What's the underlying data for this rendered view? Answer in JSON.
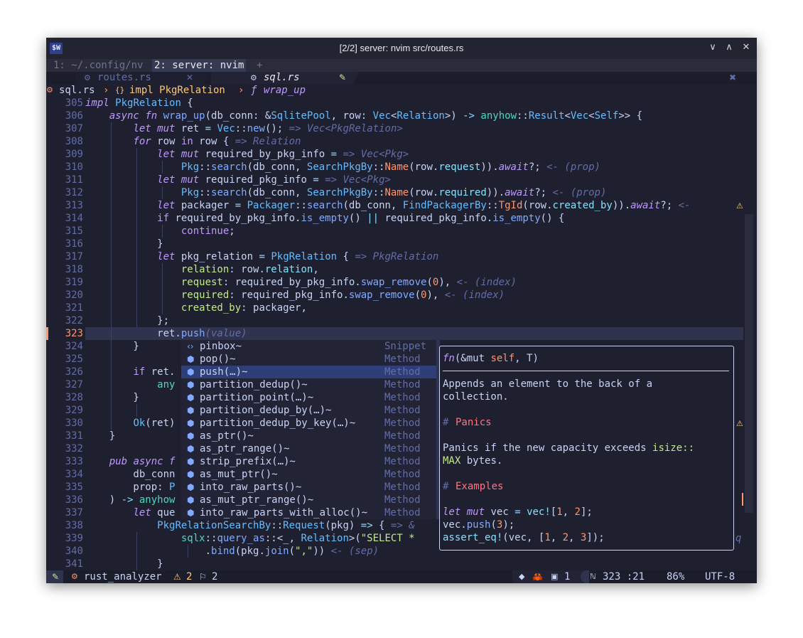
{
  "window": {
    "title": "[2/2] server: nvim src/routes.rs",
    "app_icon": "$W",
    "buttons": {
      "minimize": "∨",
      "maximize": "∧",
      "close": "✕"
    }
  },
  "tmux": {
    "window1": "1: ~/.config/nv",
    "window2": "2: server: nvim",
    "add": "+"
  },
  "tabs": {
    "tab1": "routes.rs",
    "tab1_close": "✕",
    "tab2": "sql.rs",
    "tab2_modified": "✎",
    "close_all": "✖"
  },
  "winbar": {
    "file": "sql.rs",
    "sep1": "›",
    "impl_icon": "{}",
    "impl": "impl PkgRelation",
    "sep2": "›",
    "fn_icon": "ƒ",
    "fn": "wrap_up"
  },
  "code": {
    "line_numbers": [
      "305",
      "306",
      "307",
      "308",
      "309",
      "310",
      "311",
      "312",
      "313",
      "314",
      "315",
      "316",
      "317",
      "318",
      "319",
      "320",
      "321",
      "322",
      "323",
      "324",
      "325",
      "326",
      "327",
      "328",
      "329",
      "330",
      "331",
      "332",
      "333",
      "334",
      "335",
      "336",
      "337",
      "338",
      "339",
      "340",
      "341"
    ],
    "current_line": "323"
  },
  "completion": {
    "items": [
      {
        "icon": "‹›",
        "label": "pinbox~",
        "kind": "Snippet"
      },
      {
        "icon": "⬢",
        "label": "pop()~",
        "kind": "Method"
      },
      {
        "icon": "⬢",
        "label": "push(…)~",
        "kind": "Method"
      },
      {
        "icon": "⬢",
        "label": "partition_dedup()~",
        "kind": "Method"
      },
      {
        "icon": "⬢",
        "label": "partition_point(…)~",
        "kind": "Method"
      },
      {
        "icon": "⬢",
        "label": "partition_dedup_by(…)~",
        "kind": "Method"
      },
      {
        "icon": "⬢",
        "label": "partition_dedup_by_key(…)~",
        "kind": "Method"
      },
      {
        "icon": "⬢",
        "label": "as_ptr()~",
        "kind": "Method"
      },
      {
        "icon": "⬢",
        "label": "as_ptr_range()~",
        "kind": "Method"
      },
      {
        "icon": "⬢",
        "label": "strip_prefix(…)~",
        "kind": "Method"
      },
      {
        "icon": "⬢",
        "label": "as_mut_ptr()~",
        "kind": "Method"
      },
      {
        "icon": "⬢",
        "label": "into_raw_parts()~",
        "kind": "Method"
      },
      {
        "icon": "⬢",
        "label": "as_mut_ptr_range()~",
        "kind": "Method"
      },
      {
        "icon": "⬢",
        "label": "into_raw_parts_with_alloc()~",
        "kind": "Method"
      }
    ],
    "selected_index": 2
  },
  "docs": {
    "sig_fn": "fn",
    "sig_open": "(&mut ",
    "sig_self": "self",
    "sig_rest": ", T)",
    "desc1": "Appends an element to the back of a",
    "desc2": "collection.",
    "h_panics_hash": "#",
    "h_panics": "Panics",
    "panics1a": "Panics if the new capacity exceeds ",
    "panics1b": "isize::",
    "panics2a": "MAX",
    "panics2b": " bytes.",
    "h_examples_hash": "#",
    "h_examples": "Examples",
    "ex1": "let mut vec = vec![1, 2];",
    "ex2": "vec.push(3);",
    "ex3": "assert_eq!(vec, [1, 2, 3]);"
  },
  "status": {
    "mode_icon": "✎",
    "lsp_icon": "⚙",
    "lsp": "rust_analyzer",
    "warn_icon": "⚠",
    "warnings": "2",
    "hint_icon": "⚐",
    "hints": "2",
    "git_icon": "◆",
    "crab_icon": "🦀",
    "buffer_icon": "▣",
    "buffers": "1",
    "line_col": "323 :21",
    "percent": "86%",
    "encoding": "UTF-8"
  },
  "colors": {
    "background": "#1e2030",
    "keyword": "#c099ff",
    "function": "#82aaff",
    "type": "#65bcff",
    "string": "#c3e88d",
    "number": "#ff966c",
    "hint": "#636da6",
    "accent": "#ff966c"
  }
}
